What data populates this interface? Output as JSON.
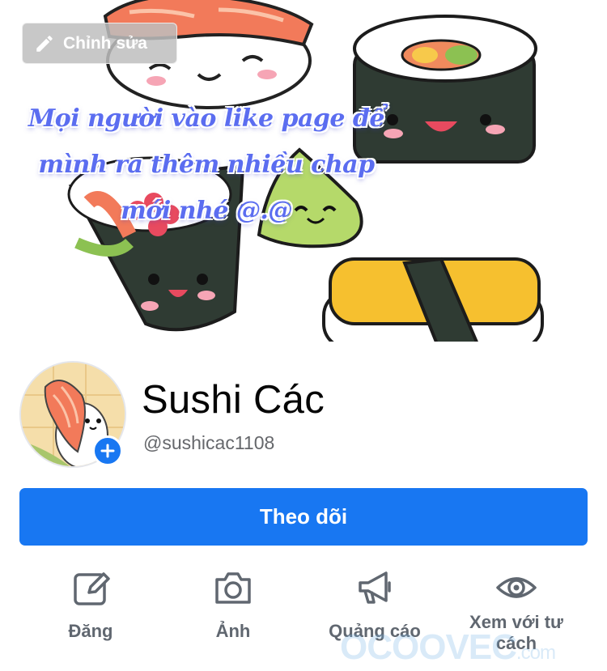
{
  "cover": {
    "edit_label": "Chỉnh sửa",
    "promo_lines": [
      "Mọi người vào like page để",
      "mình ra thêm nhiều chap",
      "mới nhé @.@"
    ]
  },
  "profile": {
    "name": "Sushi Các",
    "handle": "@sushicac1108"
  },
  "follow_label": "Theo dõi",
  "actions": [
    {
      "label": "Đăng",
      "icon": "edit-icon"
    },
    {
      "label": "Ảnh",
      "icon": "camera-icon"
    },
    {
      "label": "Quảng cáo",
      "icon": "megaphone-icon"
    },
    {
      "label": "Xem với tư cách",
      "icon": "eye-icon"
    }
  ],
  "watermark": {
    "brand": "OCOOVEC",
    "suffix": ".com"
  },
  "colors": {
    "accent": "#1877f2",
    "icon_gray": "#606770",
    "promo_text": "#5b6df0"
  }
}
